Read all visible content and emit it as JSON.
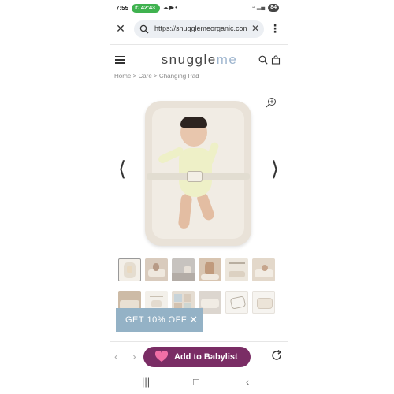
{
  "status_bar": {
    "time": "7:55",
    "call_timer": "42:43",
    "notification_icons": [
      "cloud-icon",
      "youtube-icon",
      "dot-icon"
    ],
    "battery": "84"
  },
  "browser": {
    "url": "https://snugglemeorganic.com",
    "close_icon": "close-icon",
    "menu_icon": "more-vertical-icon"
  },
  "site": {
    "logo_main": "snuggle",
    "logo_accent": "me"
  },
  "breadcrumb": "Home  >  Care  >  Changing Pad",
  "gallery": {
    "thumbnail_row1_count": 6,
    "thumbnail_row2_count": 6,
    "colors": {
      "pad": "#e9e2d8",
      "onesie": "#eef0c7"
    }
  },
  "promo": {
    "label": "GET 10% OFF",
    "bg_color": "#94b2c6"
  },
  "toolbar": {
    "babylist_label": "Add to Babylist",
    "babylist_color": "#7a2d65"
  }
}
